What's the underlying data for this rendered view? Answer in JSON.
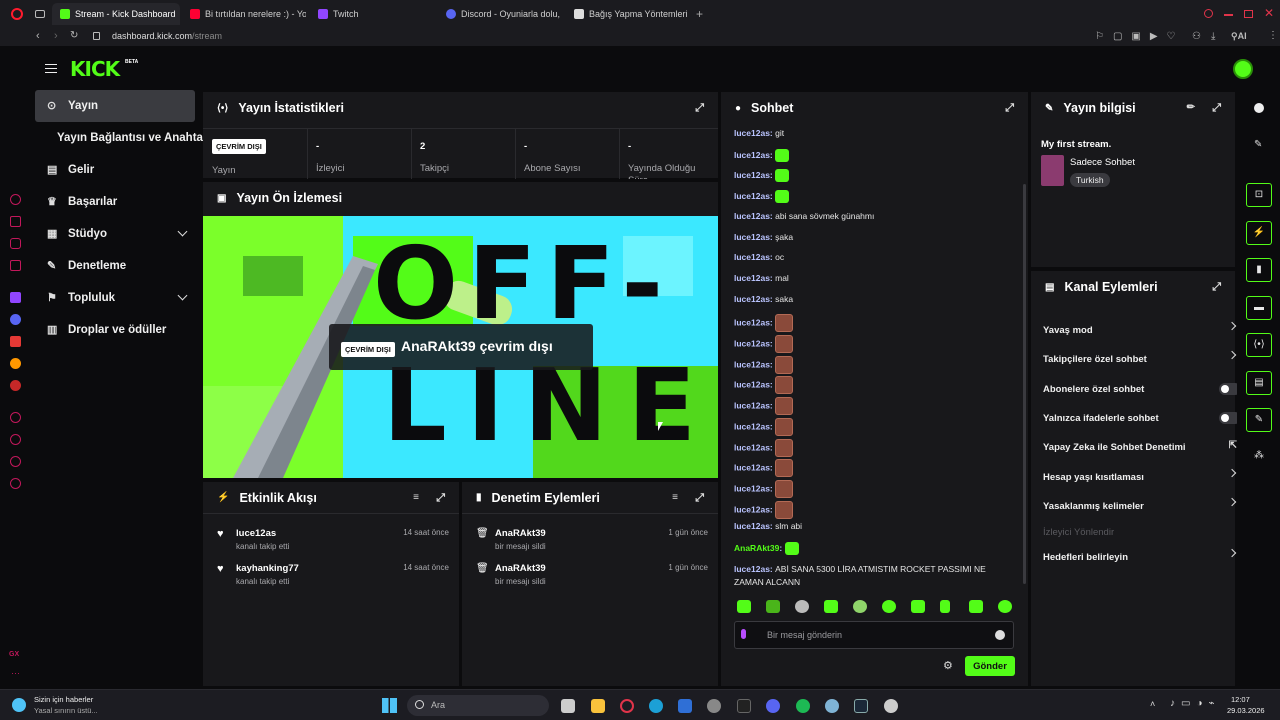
{
  "browser": {
    "tabs": [
      {
        "label": "Stream - Kick Dashboard",
        "color": "#53fc18"
      },
      {
        "label": "Bi tırtıldan nerelere :) - Yo",
        "color": "#ff0033"
      },
      {
        "label": "Twitch",
        "color": "#9146ff"
      },
      {
        "label": "Discord - Oyuniarla dolu,",
        "color": "#5865f2"
      },
      {
        "label": "Bağış Yapma Yöntemleri",
        "color": "#dddddd"
      }
    ],
    "url_host": "dashboard.kick.com",
    "url_path": "/stream"
  },
  "header": {
    "logo": "KICK",
    "beta": "BETA"
  },
  "nav": {
    "items": [
      {
        "label": "Yayın",
        "icon": "broadcast-icon"
      },
      {
        "label": "Yayın Bağlantısı ve Anahtarı",
        "icon": ""
      },
      {
        "label": "Gelir",
        "icon": "revenue-icon"
      },
      {
        "label": "Başarılar",
        "icon": "trophy-icon"
      },
      {
        "label": "Stüdyo",
        "icon": "studio-icon"
      },
      {
        "label": "Denetleme",
        "icon": "wrench-icon"
      },
      {
        "label": "Topluluk",
        "icon": "community-icon"
      },
      {
        "label": "Droplar ve ödüller",
        "icon": "drops-icon"
      }
    ]
  },
  "stats": {
    "title": "Yayın İstatistikleri",
    "status_badge": "ÇEVRİM DIŞI",
    "status_label": "Yayın",
    "items": [
      {
        "value": "-",
        "label": "İzleyici"
      },
      {
        "value": "2",
        "label": "Takipçi"
      },
      {
        "value": "-",
        "label": "Abone Sayısı"
      },
      {
        "value": "-",
        "label": "Yayında Olduğu Süre"
      }
    ]
  },
  "preview": {
    "title": "Yayın Ön İzlemesi",
    "badge": "ÇEVRİM DIŞI",
    "text": "AnaRAkt39 çevrim dışı",
    "bg_letters_1": "OFF-",
    "bg_letters_2": "LINE"
  },
  "activity": {
    "title": "Etkinlik Akışı",
    "rows": [
      {
        "name": "luce12as",
        "sub": "kanalı takip etti",
        "time": "14 saat önce"
      },
      {
        "name": "kayhanking77",
        "sub": "kanalı takip etti",
        "time": "14 saat önce"
      }
    ]
  },
  "moderation": {
    "title": "Denetim Eylemleri",
    "rows": [
      {
        "name": "AnaRAkt39",
        "sub": "bir mesajı sildi",
        "time": "1 gün önce"
      },
      {
        "name": "AnaRAkt39",
        "sub": "bir mesajı sildi",
        "time": "1 gün önce"
      }
    ]
  },
  "chat": {
    "title": "Sohbet",
    "messages": [
      {
        "user": "luce12as",
        "text": "git",
        "emote": ""
      },
      {
        "user": "luce12as",
        "text": "",
        "emote": "g"
      },
      {
        "user": "luce12as",
        "text": "",
        "emote": "g"
      },
      {
        "user": "luce12as",
        "text": "",
        "emote": "g"
      },
      {
        "user": "luce12as",
        "text": "abi sana sövmek günahmı",
        "emote": ""
      },
      {
        "user": "luce12as",
        "text": "şaka",
        "emote": ""
      },
      {
        "user": "luce12as",
        "text": "oc",
        "emote": ""
      },
      {
        "user": "luce12as",
        "text": "mal",
        "emote": ""
      },
      {
        "user": "luce12as",
        "text": "saka",
        "emote": ""
      },
      {
        "user": "luce12as",
        "text": "",
        "emote": "m"
      },
      {
        "user": "luce12as",
        "text": "",
        "emote": "m"
      },
      {
        "user": "luce12as",
        "text": "",
        "emote": "m"
      },
      {
        "user": "luce12as",
        "text": "",
        "emote": "m"
      },
      {
        "user": "luce12as",
        "text": "",
        "emote": "m"
      },
      {
        "user": "luce12as",
        "text": "",
        "emote": "m"
      },
      {
        "user": "luce12as",
        "text": "",
        "emote": "m"
      },
      {
        "user": "luce12as",
        "text": "",
        "emote": "m"
      },
      {
        "user": "luce12as",
        "text": "",
        "emote": "m"
      },
      {
        "user": "luce12as",
        "text": "",
        "emote": "m"
      },
      {
        "user": "luce12as",
        "text": "slm abi",
        "emote": ""
      },
      {
        "user": "AnaRAkt39",
        "text": "",
        "emote": "g"
      },
      {
        "user": "luce12as",
        "text": "ABİ SANA 5300 LİRA ATMISTIM ROCKET PASSIMI NE ZAMAN ALCANN",
        "emote": ""
      }
    ],
    "input_placeholder": "Bir mesaj gönderin",
    "send_label": "Gönder"
  },
  "stream_info": {
    "title": "Yayın bilgisi",
    "stream_title": "My first stream.",
    "category": "Sadece Sohbet",
    "language": "Turkish"
  },
  "channel_actions": {
    "title": "Kanal Eylemleri",
    "items": [
      {
        "label": "Yavaş mod",
        "control": "chevron"
      },
      {
        "label": "Takipçilere özel sohbet",
        "control": "chevron"
      },
      {
        "label": "Abonelere özel sohbet",
        "control": "toggle"
      },
      {
        "label": "Yalnızca ifadelerle sohbet",
        "control": "toggle"
      },
      {
        "label": "Yapay Zeka ile Sohbet Denetimi",
        "control": "external"
      },
      {
        "label": "Hesap yaşı kısıtlaması",
        "control": "chevron"
      },
      {
        "label": "Yasaklanmış kelimeler",
        "control": "chevron"
      },
      {
        "label": "İzleyici Yönlendir",
        "control": "disabled"
      },
      {
        "label": "Hedefleri belirleyin",
        "control": "chevron"
      }
    ]
  },
  "taskbar": {
    "news_title": "Sizin için haberler",
    "news_sub": "Yasal sınırın üstü...",
    "search_placeholder": "Ara",
    "time": "12:07",
    "date": "29.03.2026"
  },
  "colors": {
    "accent": "#53fc18",
    "panel": "#18181b",
    "bg": "#0b0b0d"
  }
}
